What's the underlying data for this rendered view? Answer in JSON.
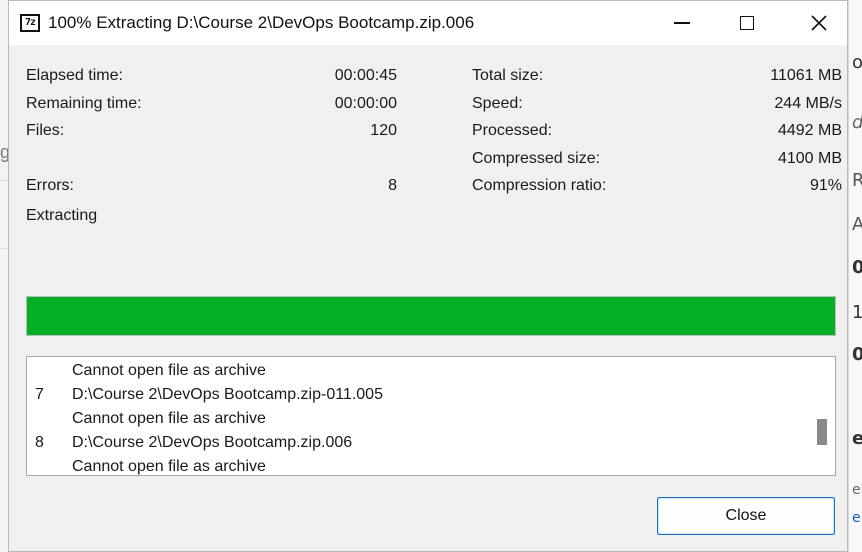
{
  "window": {
    "title": "100% Extracting D:\\Course 2\\DevOps Bootcamp.zip.006",
    "icon_text": "7z"
  },
  "stats_left": [
    {
      "label": "Elapsed time:",
      "value": "00:00:45"
    },
    {
      "label": "Remaining time:",
      "value": "00:00:00"
    },
    {
      "label": "Files:",
      "value": "120"
    },
    {
      "label": "Errors:",
      "value": "8"
    }
  ],
  "stats_right": [
    {
      "label": "Total size:",
      "value": "11061 MB"
    },
    {
      "label": "Speed:",
      "value": "244 MB/s"
    },
    {
      "label": "Processed:",
      "value": "4492 MB"
    },
    {
      "label": "Compressed size:",
      "value": "4100 MB"
    },
    {
      "label": "Compression ratio:",
      "value": "91%"
    }
  ],
  "status_text": "Extracting",
  "progress": {
    "percent": 100,
    "color": "#06b025"
  },
  "log": [
    {
      "num": "",
      "text": "Cannot open file as archive"
    },
    {
      "num": "7",
      "text": "D:\\Course 2\\DevOps Bootcamp.zip-011.005"
    },
    {
      "num": "",
      "text": "Cannot open file as archive"
    },
    {
      "num": "8",
      "text": "D:\\Course 2\\DevOps Bootcamp.zip.006"
    },
    {
      "num": "",
      "text": "Cannot open file as archive"
    }
  ],
  "buttons": {
    "close_label": "Close"
  },
  "background_app": {
    "fragments": [
      "ou",
      "d",
      "R",
      "A",
      "0",
      "1",
      "0",
      "ea",
      "ele",
      "e"
    ],
    "left_fragment": "g"
  }
}
